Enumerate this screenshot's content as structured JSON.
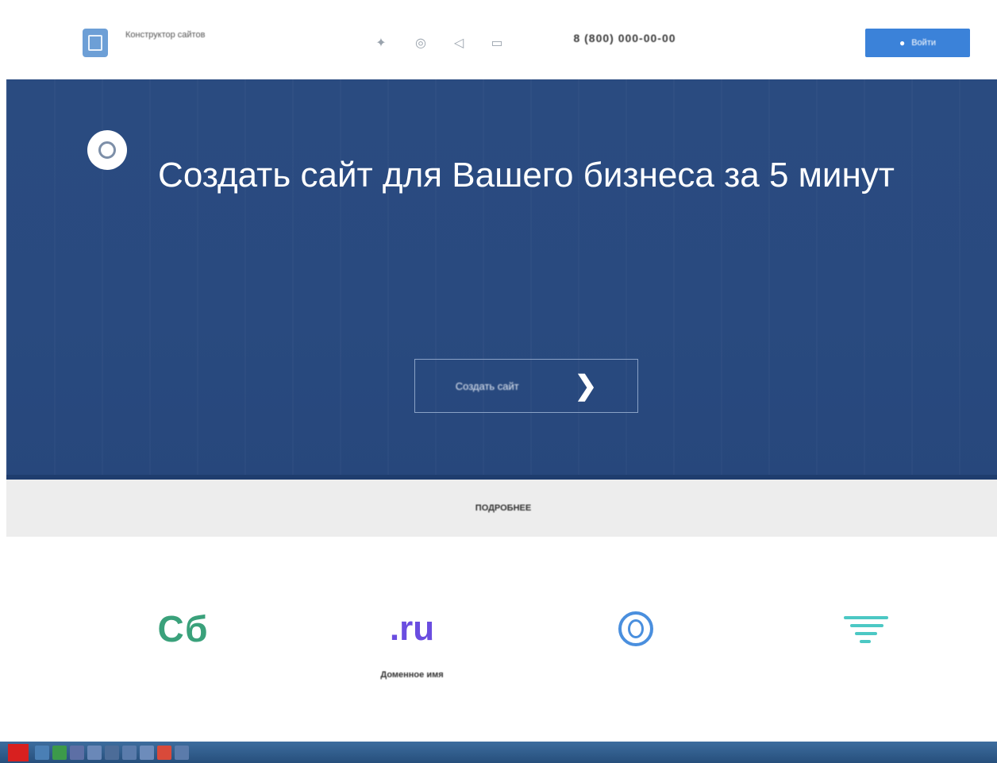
{
  "header": {
    "brand_name": "Конструктор сайтов",
    "brand_sub": "",
    "contact1": {
      "label": "",
      "value": "8 (800) 000-00-00"
    },
    "contact2": {
      "label": "",
      "value": ""
    },
    "login_label": "Войти",
    "icons": [
      "vk-icon",
      "ok-icon",
      "fb-icon",
      "mail-icon"
    ]
  },
  "hero": {
    "title": "Создать сайт для Вашего бизнеса за 5 минут",
    "description": "",
    "cta_label": "Создать сайт",
    "cta_icon": "chevron-right-icon"
  },
  "strip": {
    "text": "",
    "link": "ПОДРОБНЕЕ"
  },
  "features": [
    {
      "icon": "sb-icon",
      "icon_text": "Сб",
      "title": "",
      "text": ""
    },
    {
      "icon": "ru-domain-icon",
      "icon_text": ".ru",
      "title": "Доменное имя",
      "text": ""
    },
    {
      "icon": "globe-icon",
      "icon_text": "",
      "title": "",
      "text": ""
    },
    {
      "icon": "lines-icon",
      "icon_text": "",
      "title": "",
      "text": ""
    }
  ],
  "colors": {
    "hero_bg": "#294a7f",
    "accent_blue": "#3b82d9",
    "green": "#3aa17b",
    "purple": "#6a4de0",
    "teal": "#4cc8c4"
  }
}
